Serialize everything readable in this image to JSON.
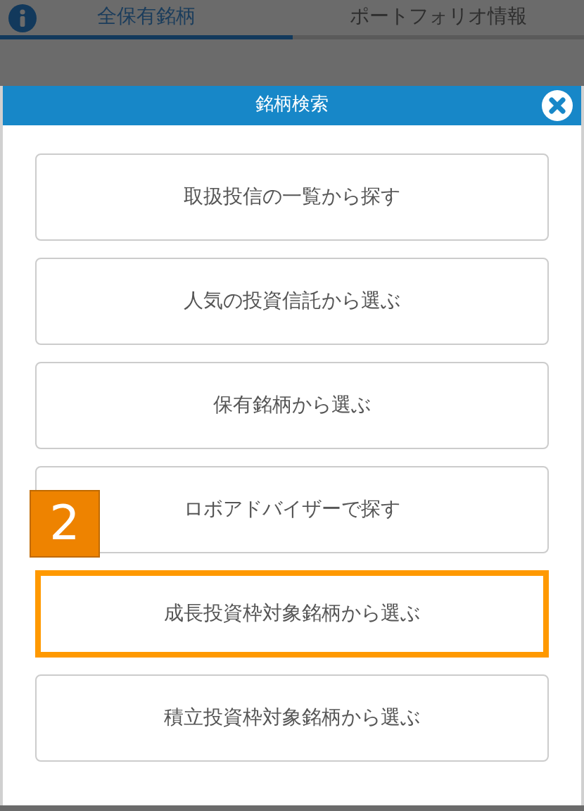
{
  "tabs": [
    {
      "label": "全保有銘柄",
      "selected": true
    },
    {
      "label": "ポートフォリオ情報",
      "selected": false
    }
  ],
  "dialog": {
    "title": "銘柄検索"
  },
  "options": [
    {
      "label": "取扱投信の一覧から探す",
      "selected": false
    },
    {
      "label": "人気の投資信託から選ぶ",
      "selected": false
    },
    {
      "label": "保有銘柄から選ぶ",
      "selected": false
    },
    {
      "label": "ロボアドバイザーで探す",
      "selected": false
    },
    {
      "label": "成長投資枠対象銘柄から選ぶ",
      "selected": true
    },
    {
      "label": "積立投資枠対象銘柄から選ぶ",
      "selected": false
    }
  ],
  "step_badge": "2"
}
